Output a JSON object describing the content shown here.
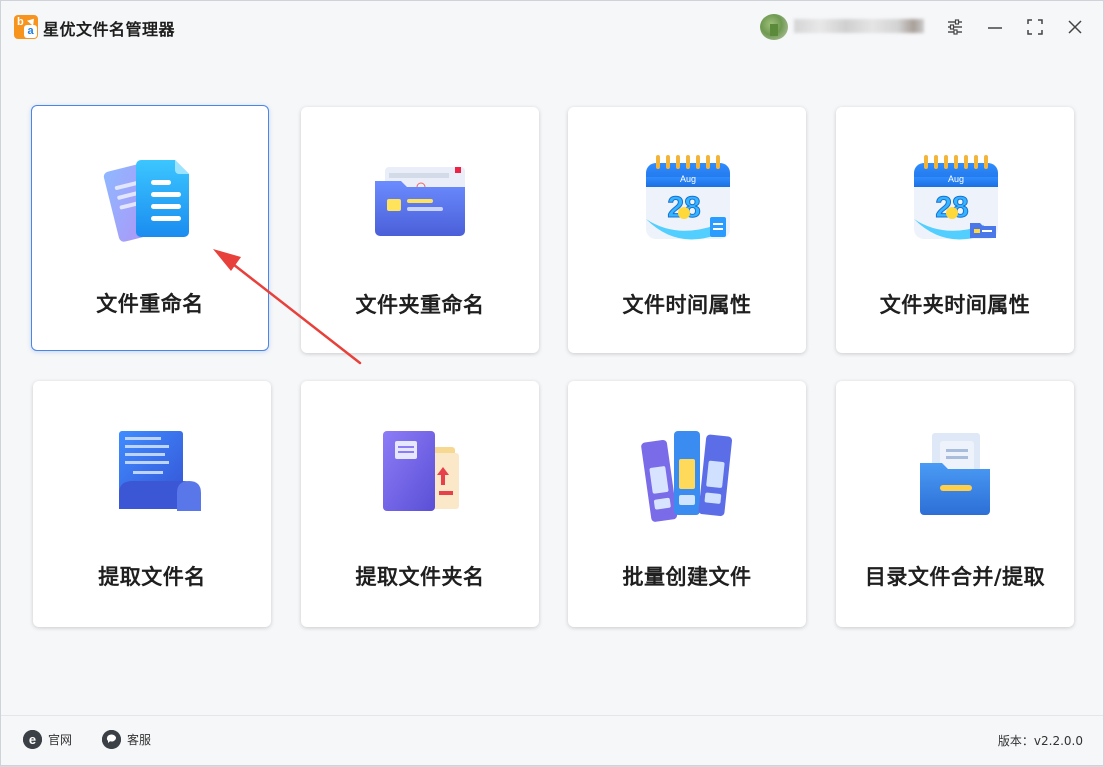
{
  "window": {
    "title": "星优文件名管理器",
    "logo_letters": [
      "b",
      "a"
    ]
  },
  "header": {
    "user_name": "",
    "controls": [
      "settings-icon",
      "minimize-icon",
      "maximize-icon",
      "close-icon"
    ]
  },
  "tools": [
    {
      "label": "文件重命名",
      "icon": "file-documents-icon",
      "selected": true
    },
    {
      "label": "文件夹重命名",
      "icon": "folder-card-icon",
      "selected": false
    },
    {
      "label": "文件时间属性",
      "icon": "calendar-file-icon",
      "selected": false
    },
    {
      "label": "文件夹时间属性",
      "icon": "calendar-folder-icon",
      "selected": false
    },
    {
      "label": "提取文件名",
      "icon": "scroll-document-icon",
      "selected": false
    },
    {
      "label": "提取文件夹名",
      "icon": "book-folder-icon",
      "selected": false
    },
    {
      "label": "批量创建文件",
      "icon": "binders-icon",
      "selected": false
    },
    {
      "label": "目录文件合并/提取",
      "icon": "file-box-icon",
      "selected": false
    }
  ],
  "calendar_text": {
    "month": "Aug",
    "day": "28"
  },
  "footer": {
    "website_label": "官网",
    "service_label": "客服",
    "version_text": "版本：v2.2.0.0"
  },
  "colors": {
    "selected_border": "#4a86e8",
    "annotation_arrow": "#e8403a",
    "logo_orange": "#f7941d"
  }
}
